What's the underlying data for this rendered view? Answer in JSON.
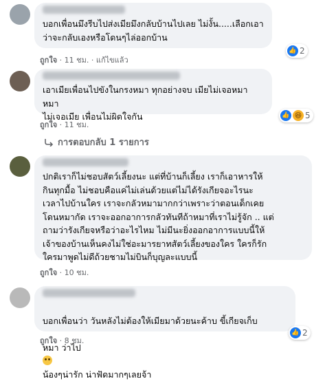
{
  "comments": [
    {
      "text": "บอกเพื่อนมึงรีบไปส่งเมียมึงกลับบ้านไปเลย ไม่งั้น.....เลือกเอา\nว่าจะกลับเองหรือโดนๆไล่ออกบ้าน",
      "like_label": "ถูกใจ",
      "time": "11 ชม.",
      "edited": "แก้ไขแล้ว",
      "reaction_count": "2"
    },
    {
      "text": "เอาเมียเพื่อนไปขังในกรงหมา ทุกอย่างจบ เมียไม่เจอหมา หมา\nไม่เจอเมีย เพื่อนไม่ผิดใจกัน",
      "like_label": "ถูกใจ",
      "time": "11 ชม.",
      "reaction_count": "5"
    },
    {
      "text": "ปกติเราก็ไม่ชอบสัตว์เลี้ยงนะ แต่ที่บ้านก็เลี้ยง เราก็เอาหารให้\nกินทุกมื้อ ไม่ชอบคือแค่ไม่เล่นด้วยแต่ไม่ได้รังเกียจอะไรนะ\nเวลาไปบ้านใคร เราจะกลัวหมามากกว่าเพราะว่าตอนเด็กเคย\nโดนหมากัด เราจะออกอาการกลัวทันทีถ้าหมาที่เราไม่รู้จัก .. แต่\nถามว่ารังเกียจหรือว่าอะไรไหม ไม่มีนะยิ่งออกอาการแบบนี้ให้\nเจ้าของบ้านเห็นคงไม่ใช่อะมารยาทสัตว์เลี้ยงของใคร ใครก็รัก\nใครมาพูดไม่ดีถ้วยชามไม่บินก็บุญละแบบนี้",
      "like_label": "ถูกใจ",
      "time": "10 ชม."
    },
    {
      "text_line1": "บอกเพื่อนว่า วันหลังไม่ต้องให้เมียมาด้วยนะค้าบ ขี้เกียจเก็บ",
      "text_line2_a": "หมา ว่าไป",
      "text_line2_b": "น้องๆน่ารัก น่าฟัดมากๆเลยจ้า",
      "like_label": "ถูกใจ",
      "time": "8 ชม.",
      "reaction_count": "2"
    }
  ],
  "replies_label": "การตอบกลับ 1 รายการ",
  "sep": "·",
  "colors": {
    "like": "#1877f2",
    "haha": "#f7b125",
    "bubble": "#f0f2f5",
    "meta": "#65676b"
  },
  "icons": {
    "like": "like-reaction-icon",
    "haha": "haha-reaction-icon",
    "reply": "reply-arrow-icon"
  }
}
